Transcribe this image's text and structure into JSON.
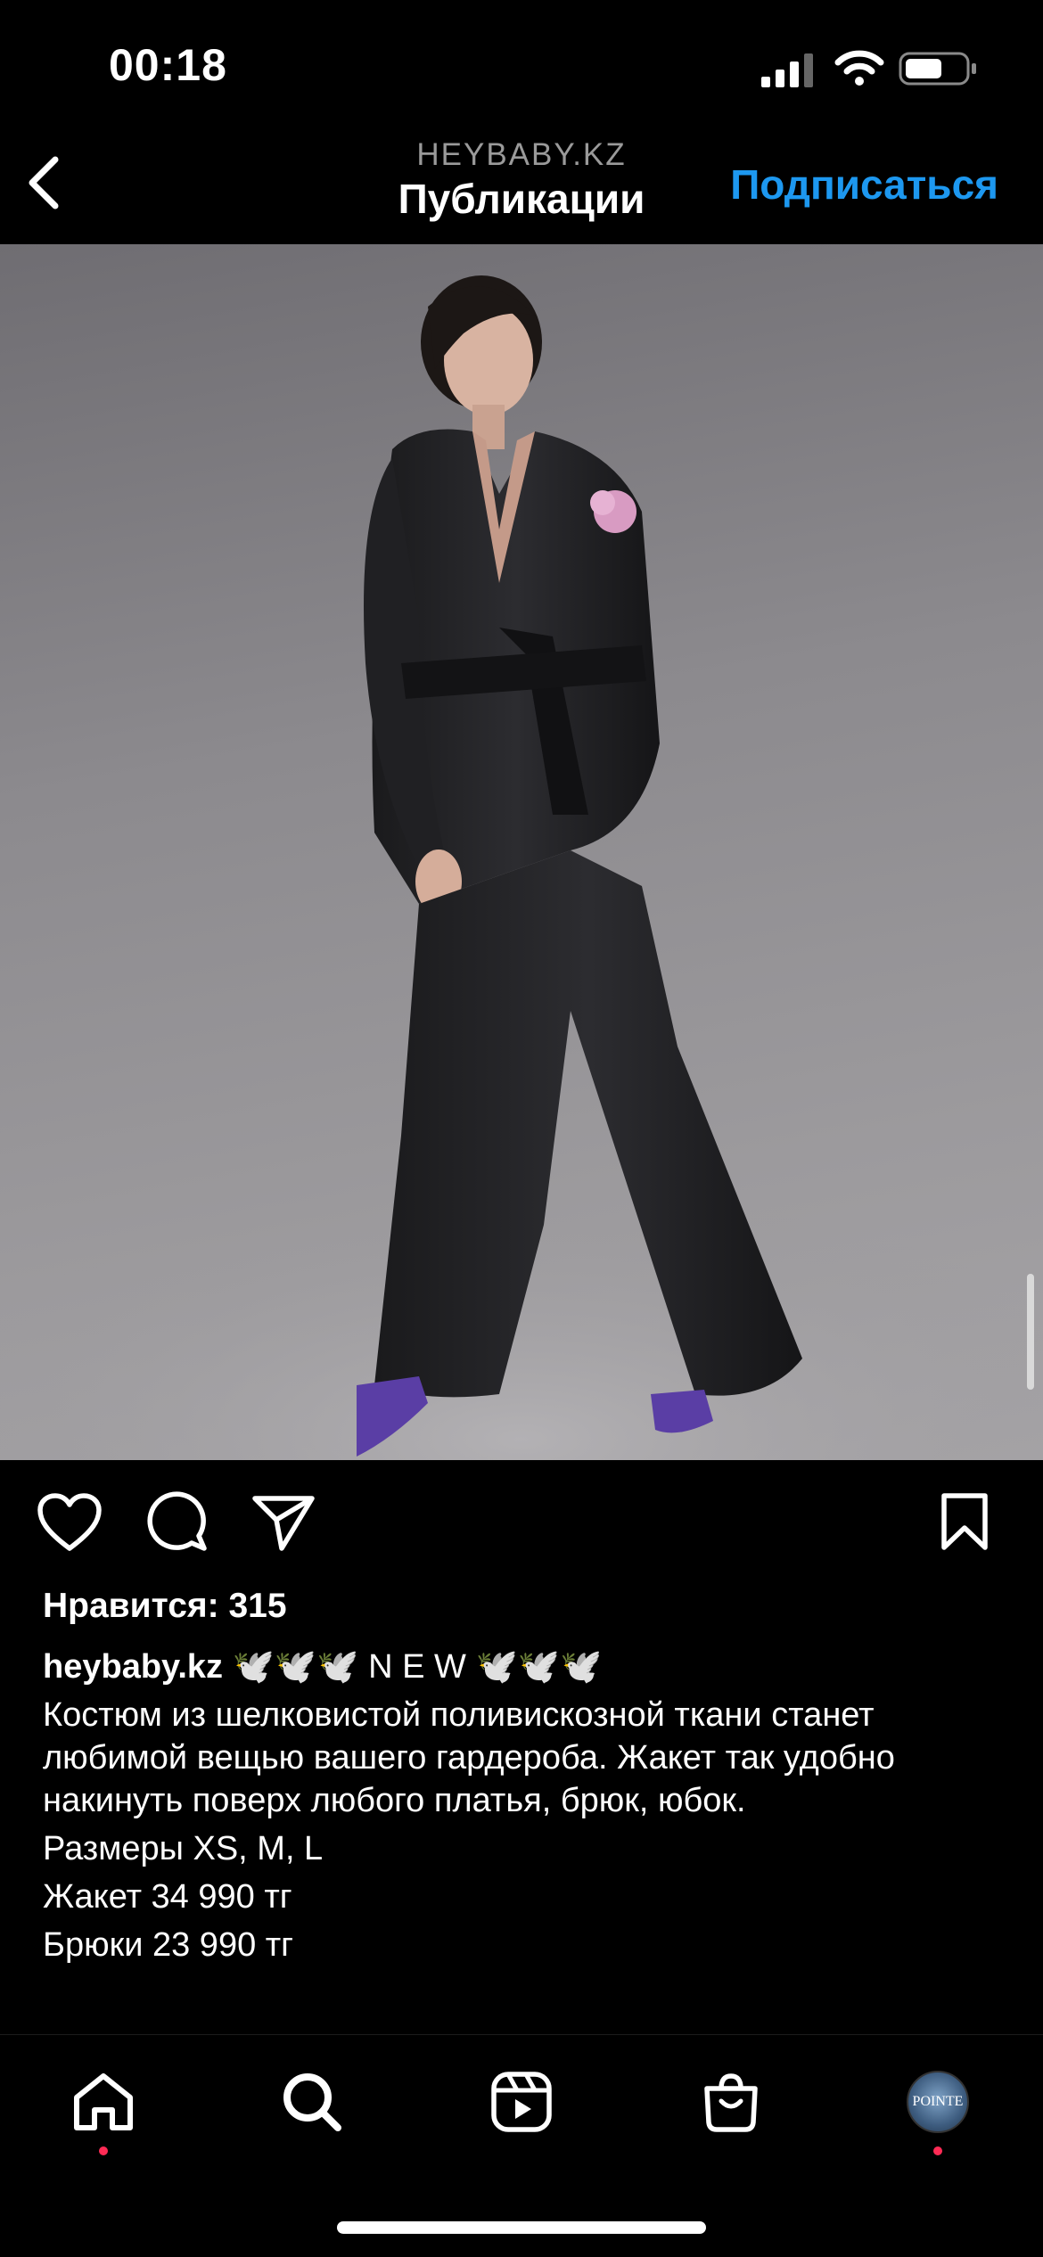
{
  "status_bar": {
    "time": "00:18"
  },
  "header": {
    "account": "HEYBABY.KZ",
    "title": "Публикации",
    "subscribe_label": "Подписаться"
  },
  "post": {
    "likes_label": "Нравится: 315",
    "username": "heybaby.kz",
    "headline": "🕊️🕊️🕊️ N E W 🕊️🕊️🕊️",
    "caption_lines": [
      "Костюм из шелковистой поливискозной ткани станет любимой вещью вашего гардероба. Жакет так удобно накинуть поверх любого платья, брюк, юбок.",
      "Размеры XS, M, L",
      "Жакет 34 990 тг",
      "Брюки 23 990 тг"
    ]
  },
  "tabbar": {
    "avatar_text": "POINTE"
  },
  "colors": {
    "accent": "#1d98f0",
    "notification_dot": "#ff2b55",
    "background": "#000000"
  }
}
